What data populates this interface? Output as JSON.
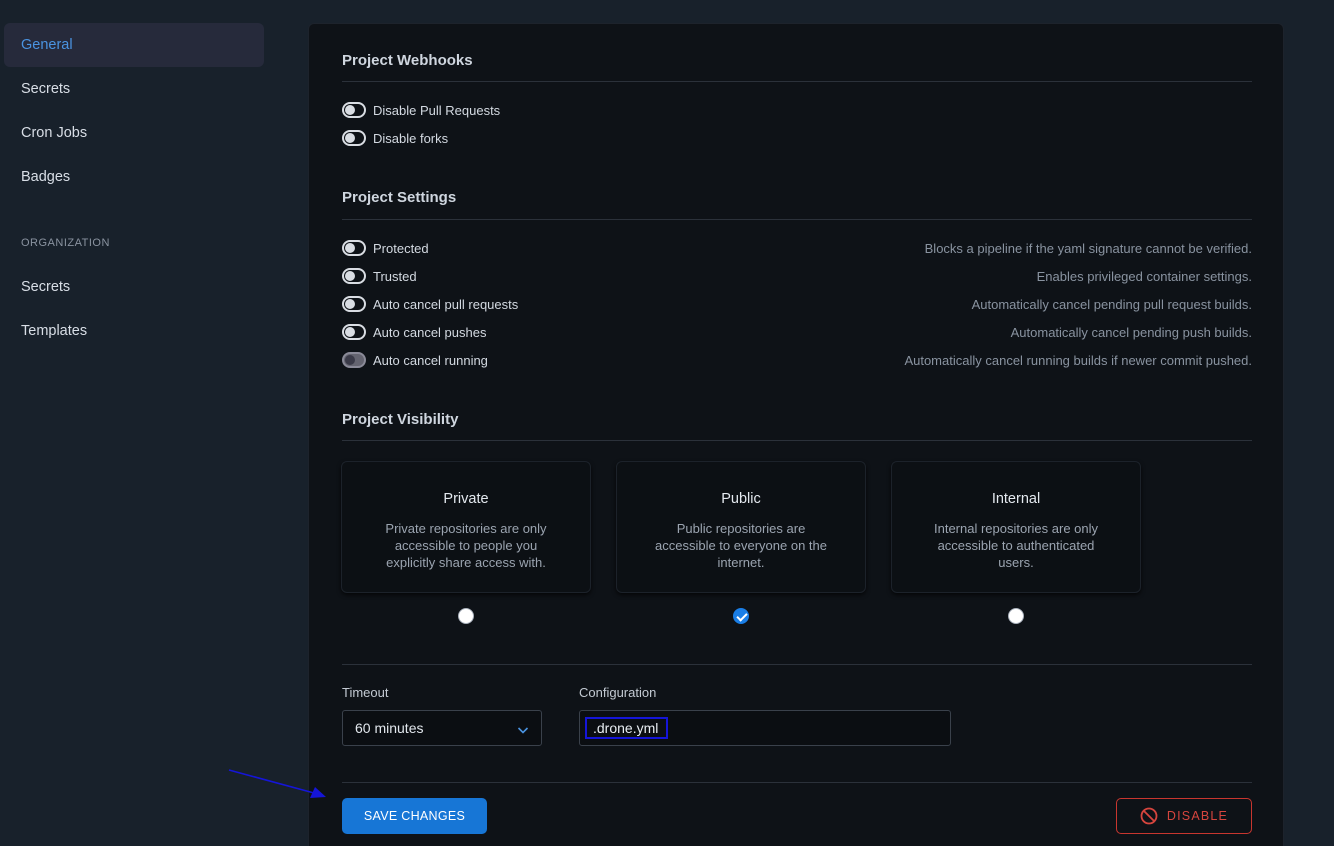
{
  "sidebar": {
    "items": [
      {
        "label": "General",
        "active": true
      },
      {
        "label": "Secrets"
      },
      {
        "label": "Cron Jobs"
      },
      {
        "label": "Badges"
      }
    ],
    "org_header": "ORGANIZATION",
    "org_items": [
      {
        "label": "Secrets"
      },
      {
        "label": "Templates"
      }
    ]
  },
  "webhooks": {
    "title": "Project Webhooks",
    "options": [
      {
        "label": "Disable Pull Requests",
        "enabled": false
      },
      {
        "label": "Disable forks",
        "enabled": false
      }
    ]
  },
  "settings": {
    "title": "Project Settings",
    "options": [
      {
        "label": "Protected",
        "desc": "Blocks a pipeline if the yaml signature cannot be verified.",
        "enabled": false
      },
      {
        "label": "Trusted",
        "desc": "Enables privileged container settings.",
        "enabled": false
      },
      {
        "label": "Auto cancel pull requests",
        "desc": "Automatically cancel pending pull request builds.",
        "enabled": false
      },
      {
        "label": "Auto cancel pushes",
        "desc": "Automatically cancel pending push builds.",
        "enabled": false
      },
      {
        "label": "Auto cancel running",
        "desc": "Automatically cancel running builds if newer commit pushed.",
        "enabled": false
      }
    ]
  },
  "visibility": {
    "title": "Project Visibility",
    "selected": "Public",
    "cards": [
      {
        "title": "Private",
        "desc": "Private repositories are only accessible to people you explicitly share access with."
      },
      {
        "title": "Public",
        "desc": "Public repositories are accessible to everyone on the internet."
      },
      {
        "title": "Internal",
        "desc": "Internal repositories are only accessible to authenticated users."
      }
    ]
  },
  "timeout": {
    "label": "Timeout",
    "value": "60 minutes"
  },
  "configuration": {
    "label": "Configuration",
    "value": ".drone.yml"
  },
  "actions": {
    "save_label": "SAVE CHANGES",
    "disable_label": "DISABLE"
  },
  "colors": {
    "accent": "#1776d6",
    "danger": "#c8362f",
    "annotation_arrow": "#1515d8"
  }
}
